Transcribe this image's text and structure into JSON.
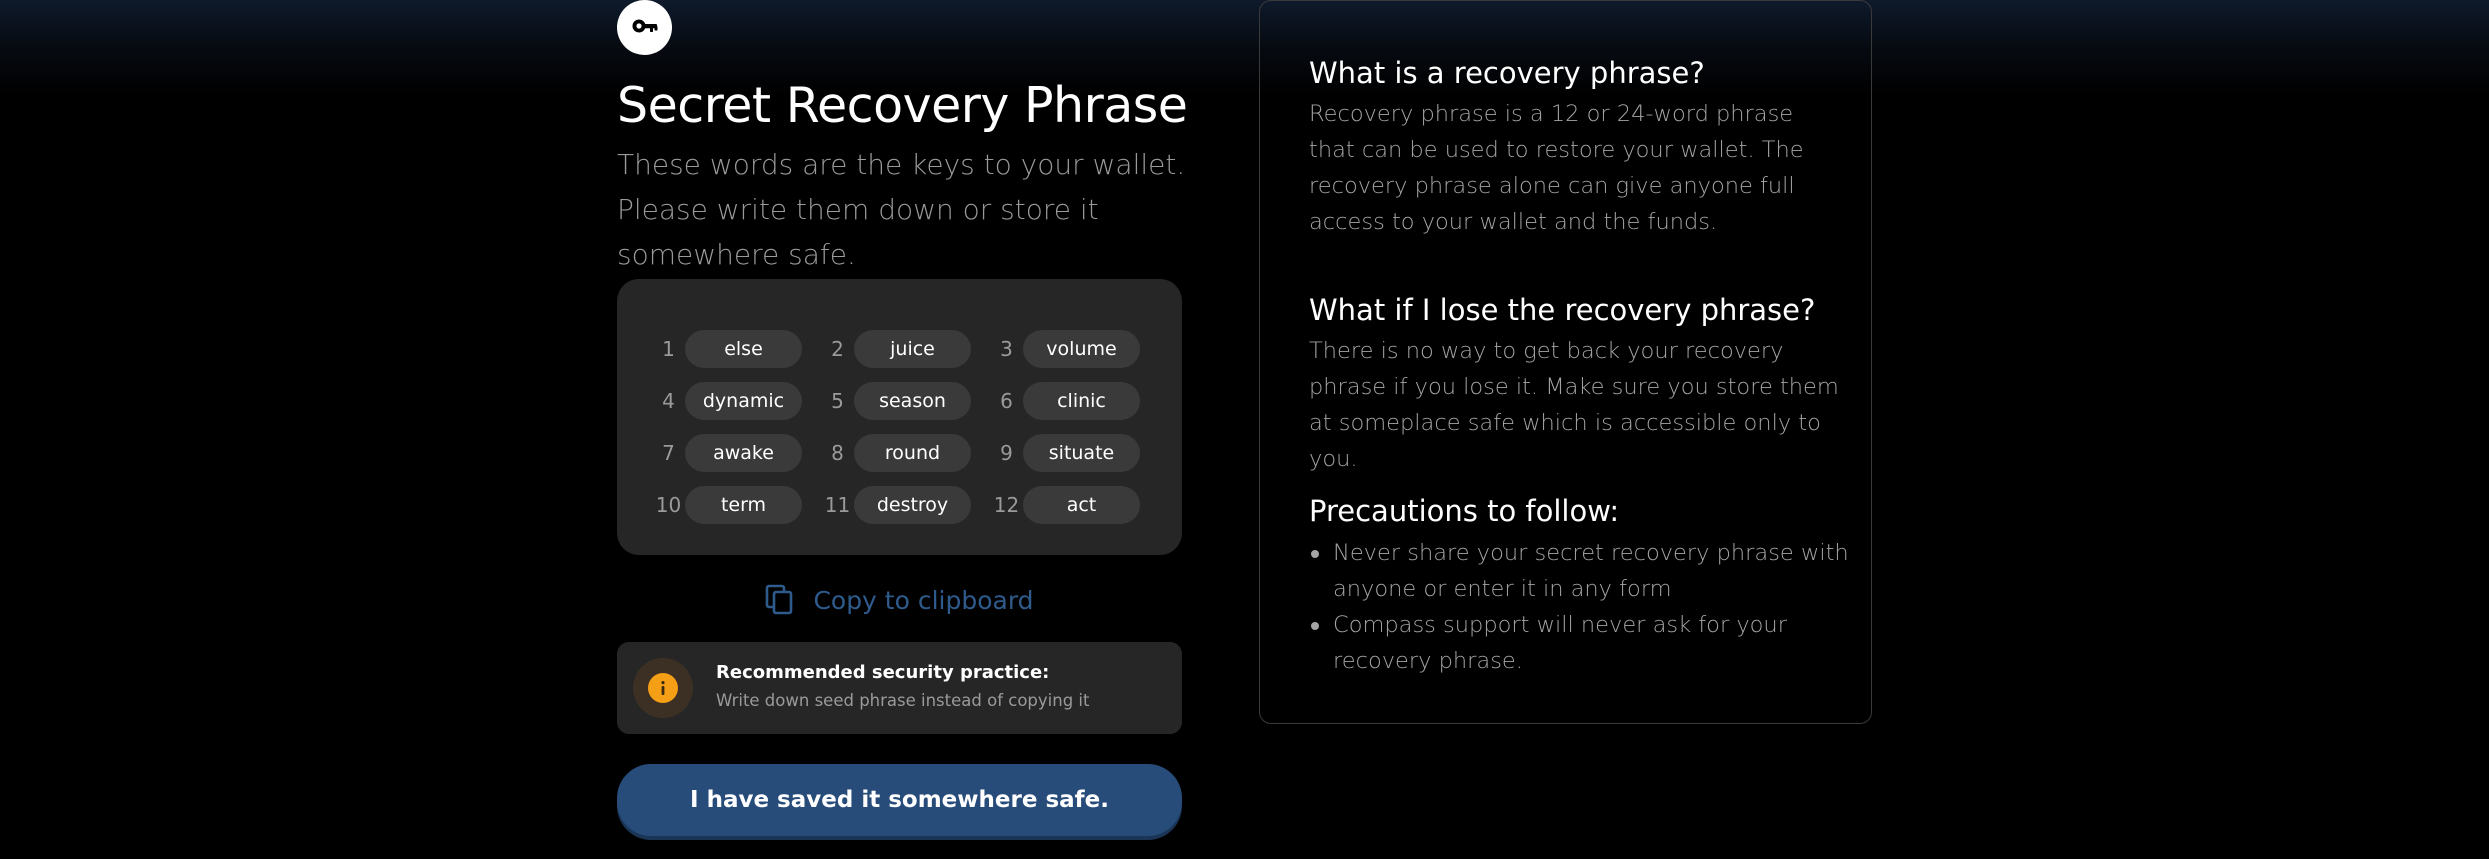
{
  "header": {
    "icon": "key-icon",
    "title": "Secret Recovery Phrase",
    "subtitle": "These words are the keys to your wallet. Please write them down or store it somewhere safe."
  },
  "words": [
    {
      "num": "1",
      "word": "else"
    },
    {
      "num": "2",
      "word": "juice"
    },
    {
      "num": "3",
      "word": "volume"
    },
    {
      "num": "4",
      "word": "dynamic"
    },
    {
      "num": "5",
      "word": "season"
    },
    {
      "num": "6",
      "word": "clinic"
    },
    {
      "num": "7",
      "word": "awake"
    },
    {
      "num": "8",
      "word": "round"
    },
    {
      "num": "9",
      "word": "situate"
    },
    {
      "num": "10",
      "word": "term"
    },
    {
      "num": "11",
      "word": "destroy"
    },
    {
      "num": "12",
      "word": "act"
    }
  ],
  "copy": {
    "label": "Copy to clipboard",
    "icon": "copy-icon",
    "color": "#2f5b8c"
  },
  "security": {
    "icon": "info-icon",
    "title": "Recommended security practice:",
    "text": "Write down seed phrase instead of copying it",
    "accent": "#f59f17"
  },
  "save_button": {
    "label": "I have saved it somewhere safe.",
    "color": "#274c7a"
  },
  "info_panel": {
    "sections": [
      {
        "heading": "What is a recovery phrase?",
        "body": "Recovery phrase is a 12 or 24-word phrase that can be used to restore your wallet. The recovery phrase alone can give anyone full access to your wallet and the funds."
      },
      {
        "heading": "What if I lose the recovery phrase?",
        "body": "There is no way to get back your recovery phrase if you lose it. Make sure you store them at someplace safe which is accessible only to you."
      },
      {
        "heading": "Precautions to follow:",
        "bullets": [
          "Never share your secret recovery phrase with anyone or enter it in any form",
          "Compass support will never ask for your recovery phrase."
        ]
      }
    ]
  }
}
